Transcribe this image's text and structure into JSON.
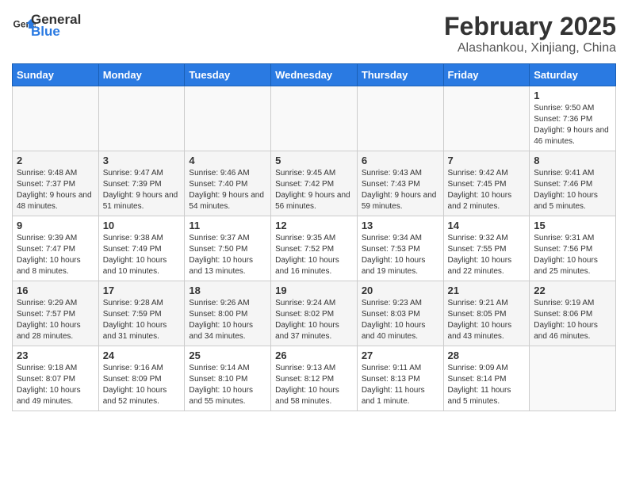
{
  "header": {
    "logo_general": "General",
    "logo_blue": "Blue",
    "month_year": "February 2025",
    "location": "Alashankou, Xinjiang, China"
  },
  "weekdays": [
    "Sunday",
    "Monday",
    "Tuesday",
    "Wednesday",
    "Thursday",
    "Friday",
    "Saturday"
  ],
  "weeks": [
    [
      {
        "day": "",
        "info": ""
      },
      {
        "day": "",
        "info": ""
      },
      {
        "day": "",
        "info": ""
      },
      {
        "day": "",
        "info": ""
      },
      {
        "day": "",
        "info": ""
      },
      {
        "day": "",
        "info": ""
      },
      {
        "day": "1",
        "info": "Sunrise: 9:50 AM\nSunset: 7:36 PM\nDaylight: 9 hours and 46 minutes."
      }
    ],
    [
      {
        "day": "2",
        "info": "Sunrise: 9:48 AM\nSunset: 7:37 PM\nDaylight: 9 hours and 48 minutes."
      },
      {
        "day": "3",
        "info": "Sunrise: 9:47 AM\nSunset: 7:39 PM\nDaylight: 9 hours and 51 minutes."
      },
      {
        "day": "4",
        "info": "Sunrise: 9:46 AM\nSunset: 7:40 PM\nDaylight: 9 hours and 54 minutes."
      },
      {
        "day": "5",
        "info": "Sunrise: 9:45 AM\nSunset: 7:42 PM\nDaylight: 9 hours and 56 minutes."
      },
      {
        "day": "6",
        "info": "Sunrise: 9:43 AM\nSunset: 7:43 PM\nDaylight: 9 hours and 59 minutes."
      },
      {
        "day": "7",
        "info": "Sunrise: 9:42 AM\nSunset: 7:45 PM\nDaylight: 10 hours and 2 minutes."
      },
      {
        "day": "8",
        "info": "Sunrise: 9:41 AM\nSunset: 7:46 PM\nDaylight: 10 hours and 5 minutes."
      }
    ],
    [
      {
        "day": "9",
        "info": "Sunrise: 9:39 AM\nSunset: 7:47 PM\nDaylight: 10 hours and 8 minutes."
      },
      {
        "day": "10",
        "info": "Sunrise: 9:38 AM\nSunset: 7:49 PM\nDaylight: 10 hours and 10 minutes."
      },
      {
        "day": "11",
        "info": "Sunrise: 9:37 AM\nSunset: 7:50 PM\nDaylight: 10 hours and 13 minutes."
      },
      {
        "day": "12",
        "info": "Sunrise: 9:35 AM\nSunset: 7:52 PM\nDaylight: 10 hours and 16 minutes."
      },
      {
        "day": "13",
        "info": "Sunrise: 9:34 AM\nSunset: 7:53 PM\nDaylight: 10 hours and 19 minutes."
      },
      {
        "day": "14",
        "info": "Sunrise: 9:32 AM\nSunset: 7:55 PM\nDaylight: 10 hours and 22 minutes."
      },
      {
        "day": "15",
        "info": "Sunrise: 9:31 AM\nSunset: 7:56 PM\nDaylight: 10 hours and 25 minutes."
      }
    ],
    [
      {
        "day": "16",
        "info": "Sunrise: 9:29 AM\nSunset: 7:57 PM\nDaylight: 10 hours and 28 minutes."
      },
      {
        "day": "17",
        "info": "Sunrise: 9:28 AM\nSunset: 7:59 PM\nDaylight: 10 hours and 31 minutes."
      },
      {
        "day": "18",
        "info": "Sunrise: 9:26 AM\nSunset: 8:00 PM\nDaylight: 10 hours and 34 minutes."
      },
      {
        "day": "19",
        "info": "Sunrise: 9:24 AM\nSunset: 8:02 PM\nDaylight: 10 hours and 37 minutes."
      },
      {
        "day": "20",
        "info": "Sunrise: 9:23 AM\nSunset: 8:03 PM\nDaylight: 10 hours and 40 minutes."
      },
      {
        "day": "21",
        "info": "Sunrise: 9:21 AM\nSunset: 8:05 PM\nDaylight: 10 hours and 43 minutes."
      },
      {
        "day": "22",
        "info": "Sunrise: 9:19 AM\nSunset: 8:06 PM\nDaylight: 10 hours and 46 minutes."
      }
    ],
    [
      {
        "day": "23",
        "info": "Sunrise: 9:18 AM\nSunset: 8:07 PM\nDaylight: 10 hours and 49 minutes."
      },
      {
        "day": "24",
        "info": "Sunrise: 9:16 AM\nSunset: 8:09 PM\nDaylight: 10 hours and 52 minutes."
      },
      {
        "day": "25",
        "info": "Sunrise: 9:14 AM\nSunset: 8:10 PM\nDaylight: 10 hours and 55 minutes."
      },
      {
        "day": "26",
        "info": "Sunrise: 9:13 AM\nSunset: 8:12 PM\nDaylight: 10 hours and 58 minutes."
      },
      {
        "day": "27",
        "info": "Sunrise: 9:11 AM\nSunset: 8:13 PM\nDaylight: 11 hours and 1 minute."
      },
      {
        "day": "28",
        "info": "Sunrise: 9:09 AM\nSunset: 8:14 PM\nDaylight: 11 hours and 5 minutes."
      },
      {
        "day": "",
        "info": ""
      }
    ]
  ]
}
